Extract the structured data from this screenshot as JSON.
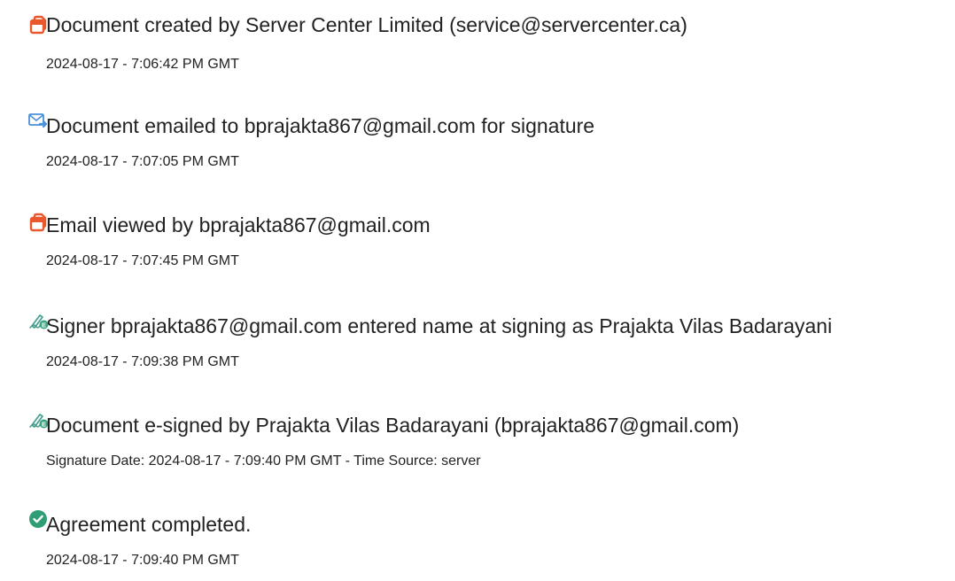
{
  "events": [
    {
      "icon": "document-created-icon",
      "title": "Document created by Server Center Limited (service@servercenter.ca)",
      "time": "2024-08-17 - 7:06:42 PM GMT"
    },
    {
      "icon": "email-sent-icon",
      "title": "Document emailed to bprajakta867@gmail.com for signature",
      "time": "2024-08-17 - 7:07:05 PM GMT"
    },
    {
      "icon": "document-viewed-icon",
      "title": "Email viewed by bprajakta867@gmail.com",
      "time": "2024-08-17 - 7:07:45 PM GMT"
    },
    {
      "icon": "e-sign-pen-icon",
      "title": "Signer bprajakta867@gmail.com entered name at signing as Prajakta Vilas Badarayani",
      "time": "2024-08-17 - 7:09:38 PM GMT"
    },
    {
      "icon": "e-sign-pen-icon",
      "title": "Document e-signed by Prajakta Vilas Badarayani (bprajakta867@gmail.com)",
      "time": "Signature Date: 2024-08-17 - 7:09:40 PM GMT - Time Source: server"
    },
    {
      "icon": "check-circle-icon",
      "title": "Agreement completed.",
      "time": "2024-08-17 - 7:09:40 PM GMT"
    }
  ],
  "colors": {
    "doc_icon": "#e8582c",
    "email_icon": "#4a90d9",
    "sign_icon": "#3aa57f",
    "check_icon": "#2f9e74",
    "text": "#222222"
  }
}
